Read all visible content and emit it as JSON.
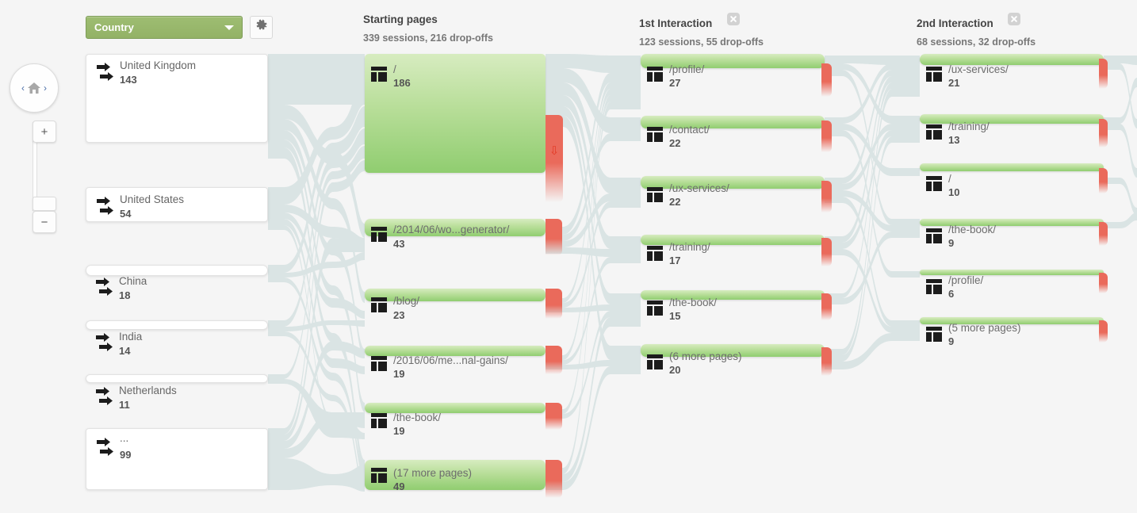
{
  "toolbar": {
    "dimension_label": "Country",
    "dimension_caret": "chevron-down-icon",
    "settings_icon": "gear-icon"
  },
  "nav": {
    "home_icon": "home-icon",
    "prev_label": "‹",
    "next_label": "›",
    "zoom_in_label": "+",
    "zoom_out_label": "−"
  },
  "columns": [
    {
      "id": "starting-pages",
      "title": "Starting pages",
      "subtitle": "339 sessions, 216 drop-offs",
      "closable": false
    },
    {
      "id": "first-interaction",
      "title": "1st Interaction",
      "subtitle": "123 sessions, 55 drop-offs",
      "closable": true,
      "close_icon": "close-icon"
    },
    {
      "id": "second-interaction",
      "title": "2nd Interaction",
      "subtitle": "68 sessions, 32 drop-offs",
      "closable": true,
      "close_icon": "close-icon"
    }
  ],
  "dimension_nodes": [
    {
      "label": "United Kingdom",
      "value": "143",
      "icon": "traffic-arrows-icon"
    },
    {
      "label": "United States",
      "value": "54",
      "icon": "traffic-arrows-icon"
    },
    {
      "label": "China",
      "value": "18",
      "icon": "traffic-arrows-icon"
    },
    {
      "label": "India",
      "value": "14",
      "icon": "traffic-arrows-icon"
    },
    {
      "label": "Netherlands",
      "value": "11",
      "icon": "traffic-arrows-icon"
    },
    {
      "label": "...",
      "value": "99",
      "icon": "traffic-arrows-icon"
    }
  ],
  "starting_pages": [
    {
      "label": "/",
      "value": "186",
      "icon": "page-icon"
    },
    {
      "label": "/2014/06/wo...generator/",
      "value": "43",
      "icon": "page-icon"
    },
    {
      "label": "/blog/",
      "value": "23",
      "icon": "page-icon"
    },
    {
      "label": "/2016/06/me...nal-gains/",
      "value": "19",
      "icon": "page-icon"
    },
    {
      "label": "/the-book/",
      "value": "19",
      "icon": "page-icon"
    },
    {
      "label": "(17 more pages)",
      "value": "49",
      "icon": "page-icon"
    }
  ],
  "first_interaction": [
    {
      "label": "/profile/",
      "value": "27",
      "icon": "page-icon"
    },
    {
      "label": "/contact/",
      "value": "22",
      "icon": "page-icon"
    },
    {
      "label": "/ux-services/",
      "value": "22",
      "icon": "page-icon"
    },
    {
      "label": "/training/",
      "value": "17",
      "icon": "page-icon"
    },
    {
      "label": "/the-book/",
      "value": "15",
      "icon": "page-icon"
    },
    {
      "label": "(6 more pages)",
      "value": "20",
      "icon": "page-icon"
    }
  ],
  "second_interaction": [
    {
      "label": "/ux-services/",
      "value": "21",
      "icon": "page-icon"
    },
    {
      "label": "/training/",
      "value": "13",
      "icon": "page-icon"
    },
    {
      "label": "/",
      "value": "10",
      "icon": "page-icon"
    },
    {
      "label": "/the-book/",
      "value": "9",
      "icon": "page-icon"
    },
    {
      "label": "/profile/",
      "value": "6",
      "icon": "page-icon"
    },
    {
      "label": "(5 more pages)",
      "value": "9",
      "icon": "page-icon"
    }
  ],
  "colors": {
    "background": "#f5f5f5",
    "ribbon": "#d6e2e2",
    "node_green_light": "#d7ecc0",
    "node_green_dark": "#90cd70",
    "dropoff_red": "#ea6a5b",
    "dropoff_arrow": "#e33b26",
    "dimension_button": "#93b266",
    "text_muted": "#777777"
  },
  "dropoff_arrow_glyph": "⇩"
}
